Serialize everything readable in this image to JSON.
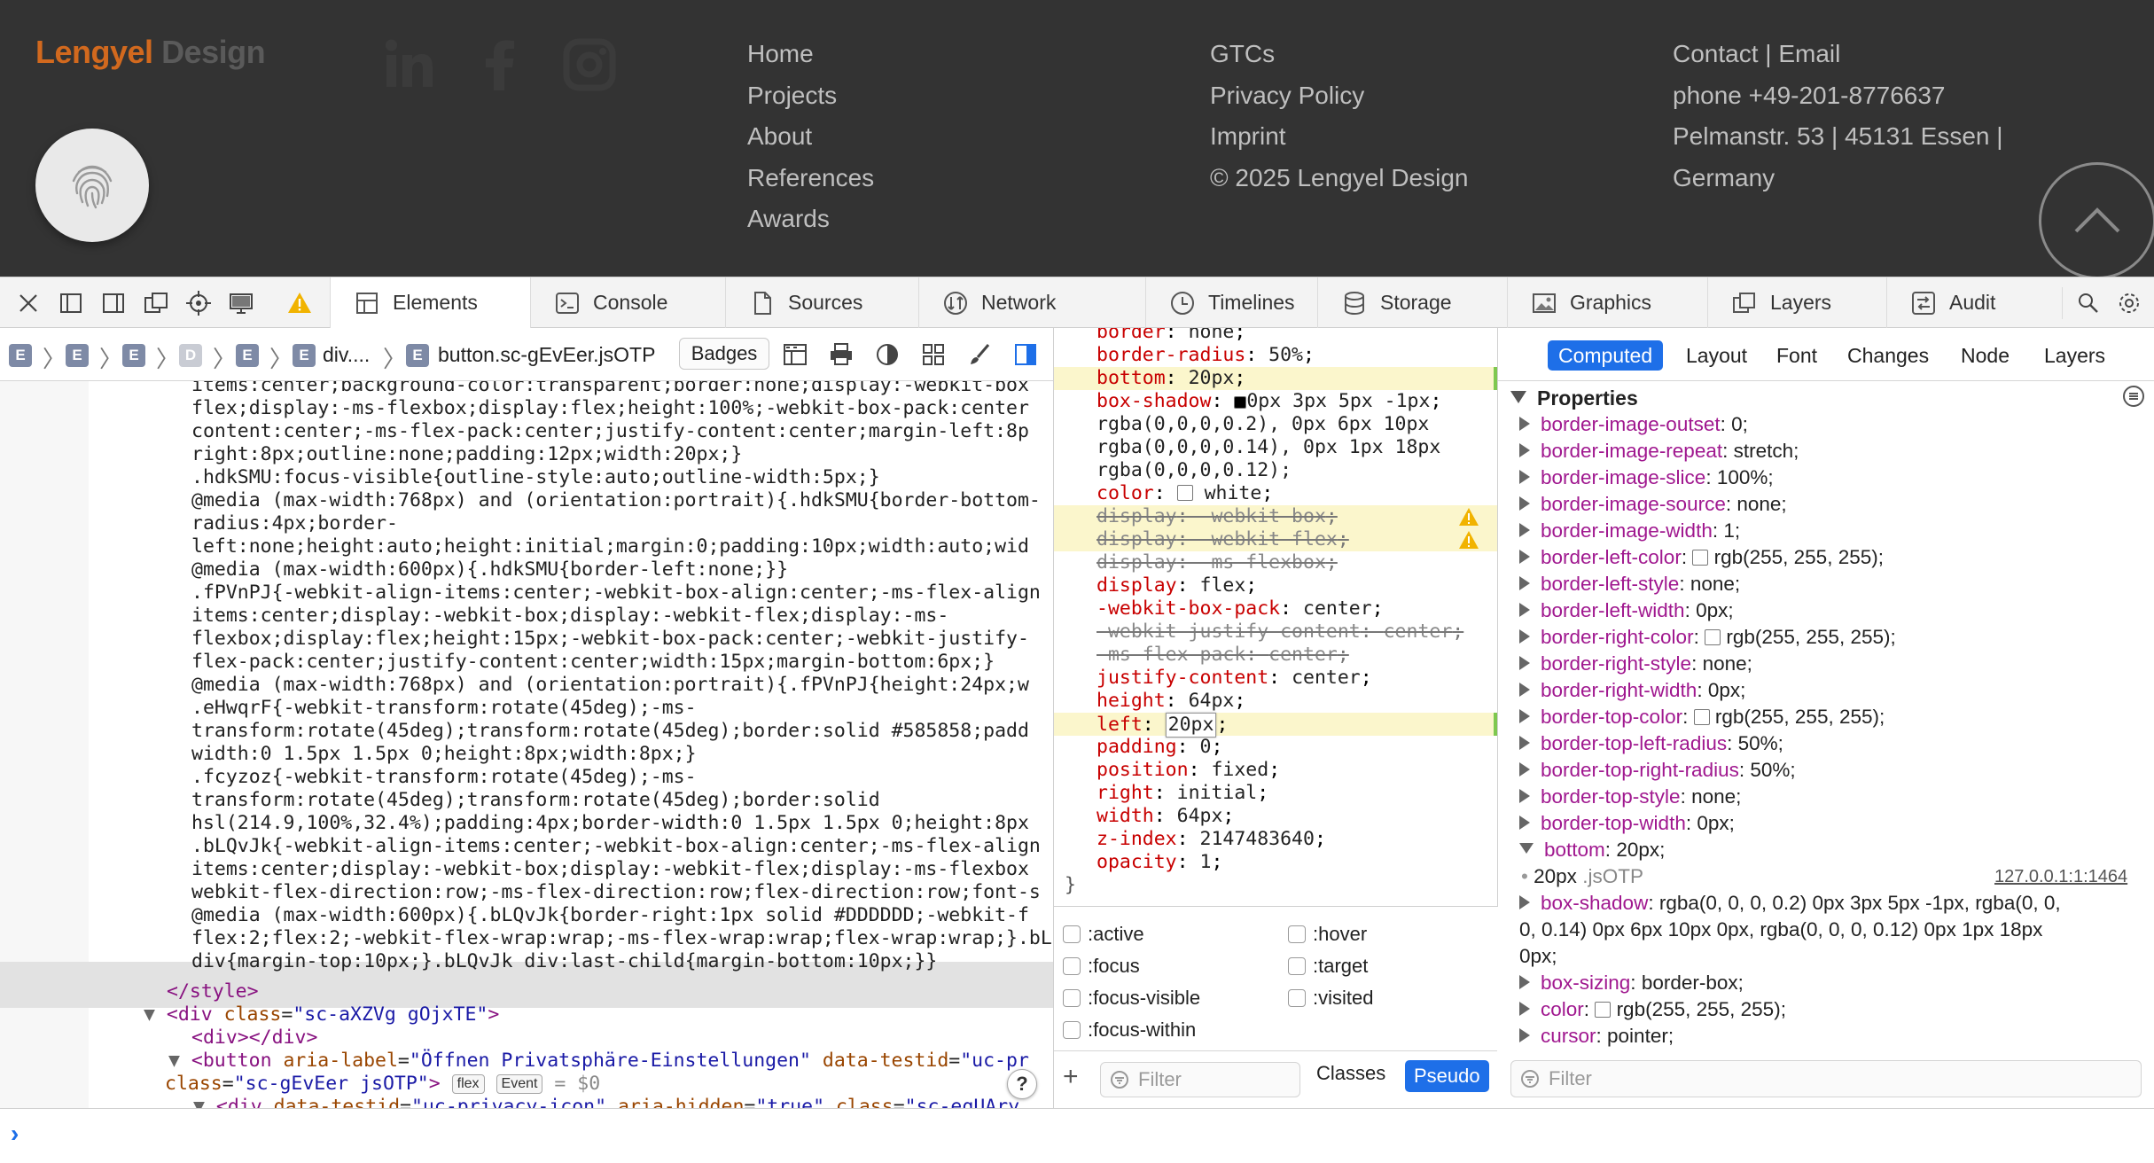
{
  "site": {
    "logo_primary": "Lengyel",
    "logo_secondary": "Design",
    "social_icons": [
      "linkedin-icon",
      "facebook-icon",
      "instagram-icon"
    ],
    "nav_links": [
      "Home",
      "Projects",
      "About",
      "References",
      "Awards"
    ],
    "legal_links": [
      "GTCs",
      "Privacy Policy",
      "Imprint",
      "© 2025 Lengyel Design"
    ],
    "contact": [
      "Contact | Email",
      "phone +49-201-8776637",
      "Pelmanstr. 53 | 45131 Essen |",
      "Germany"
    ],
    "fingerprint_button": "fingerprint-icon",
    "to_top_button": "chevron-up-icon",
    "colors": {
      "footer_bg": "#333333",
      "logo_accent": "#d2691e"
    }
  },
  "devtools": {
    "tabs": [
      "Elements",
      "Console",
      "Sources",
      "Network",
      "Timelines",
      "Storage",
      "Graphics",
      "Layers",
      "Audit"
    ],
    "active_tab": "Elements",
    "breadcrumb": {
      "items": [
        "E",
        "E",
        "E",
        "D",
        "E",
        "E"
      ],
      "current_short": "div....",
      "current": "button.sc-gEvEer.jsOTP"
    },
    "badges_label": "Badges",
    "dom_css_lines": [
      "items:center;background-color:transparent;border:none;display:-webkit-box",
      "flex;display:-ms-flexbox;display:flex;height:100%;-webkit-box-pack:center",
      "content:center;-ms-flex-pack:center;justify-content:center;margin-left:8p",
      "right:8px;outline:none;padding:12px;width:20px;}",
      ".hdkSMU:focus-visible{outline-style:auto;outline-width:5px;}",
      "@media (max-width:768px) and (orientation:portrait){.hdkSMU{border-bottom-",
      "radius:4px;border-",
      "left:none;height:auto;height:initial;margin:0;padding:10px;width:auto;wid",
      "@media (max-width:600px){.hdkSMU{border-left:none;}}",
      ".fPVnPJ{-webkit-align-items:center;-webkit-box-align:center;-ms-flex-align",
      "items:center;display:-webkit-box;display:-webkit-flex;display:-ms-",
      "flexbox;display:flex;height:15px;-webkit-box-pack:center;-webkit-justify-",
      "flex-pack:center;justify-content:center;width:15px;margin-bottom:6px;}",
      "@media (max-width:768px) and (orientation:portrait){.fPVnPJ{height:24px;w",
      ".eHwqrF{-webkit-transform:rotate(45deg);-ms-",
      "transform:rotate(45deg);transform:rotate(45deg);border:solid #585858;padd",
      "width:0 1.5px 1.5px 0;height:8px;width:8px;}",
      ".fcyzoz{-webkit-transform:rotate(45deg);-ms-",
      "transform:rotate(45deg);transform:rotate(45deg);border:solid",
      "hsl(214.9,100%,32.4%);padding:4px;border-width:0 1.5px 1.5px 0;height:8px",
      ".bLQvJk{-webkit-align-items:center;-webkit-box-align:center;-ms-flex-align",
      "items:center;display:-webkit-box;display:-webkit-flex;display:-ms-flexbox",
      "webkit-flex-direction:row;-ms-flex-direction:row;flex-direction:row;font-s",
      "@media (max-width:600px){.bLQvJk{border-right:1px solid #DDDDDD;-webkit-f",
      "flex:2;flex:2;-webkit-flex-wrap:wrap;-ms-flex-wrap:wrap;flex-wrap:wrap;}.bL",
      "div{margin-top:10px;}.bLQvJk div:last-child{margin-bottom:10px;}}"
    ],
    "dom_nodes": {
      "style_close": "</style>",
      "div_open_tag": "div",
      "div_class_attr": "class",
      "div_class_val": "\"sc-aXZVg gOjxTE\"",
      "empty_div": "<div></div>",
      "button_tag": "button",
      "button_attr1": "aria-label",
      "button_val1": "\"Öffnen Privatsphäre-Einstellungen\"",
      "button_attr2": "data-testid",
      "button_val2": "\"uc-pr",
      "button_class_attr": "class",
      "button_class_val": "\"sc-gEvEer jsOTP\"",
      "flex_badge": "flex",
      "event_badge": "Event",
      "selected_marker": "= $0",
      "child_tag": "div",
      "child_attr1": "data-testid",
      "child_val1": "\"uc-privacy-icon\"",
      "child_attr2": "aria-hidden",
      "child_val2": "\"true\"",
      "child_attr3": "class",
      "child_val3": "\"sc-eqUAry"
    },
    "help_label": "?",
    "styles": [
      {
        "name": "border",
        "value": "none",
        "state": "normal"
      },
      {
        "name": "border-radius",
        "value": "50%",
        "state": "normal"
      },
      {
        "name": "bottom",
        "value": "20px",
        "state": "highlight"
      },
      {
        "name": "box-shadow",
        "value": "0px 3px 5px -1px",
        "state": "normal"
      },
      {
        "name": "",
        "value": "rgba(0,0,0,0.2), 0px 6px 10px",
        "state": "cont"
      },
      {
        "name": "",
        "value": "rgba(0,0,0,0.14), 0px 1px 18px",
        "state": "cont"
      },
      {
        "name": "",
        "value": "rgba(0,0,0,0.12);",
        "state": "cont"
      },
      {
        "name": "color",
        "value": "white",
        "state": "normal"
      },
      {
        "name": "display",
        "value": "-webkit-box",
        "state": "struck-warn"
      },
      {
        "name": "display",
        "value": "-webkit-flex",
        "state": "struck-warn"
      },
      {
        "name": "display",
        "value": "-ms-flexbox",
        "state": "struck"
      },
      {
        "name": "display",
        "value": "flex",
        "state": "normal"
      },
      {
        "name": "-webkit-box-pack",
        "value": "center",
        "state": "normal"
      },
      {
        "name": "-webkit-justify-content",
        "value": "center",
        "state": "struck"
      },
      {
        "name": "-ms-flex-pack",
        "value": "center",
        "state": "struck"
      },
      {
        "name": "justify-content",
        "value": "center",
        "state": "normal"
      },
      {
        "name": "height",
        "value": "64px",
        "state": "normal"
      },
      {
        "name": "left",
        "value": "20px",
        "state": "editing"
      },
      {
        "name": "padding",
        "value": "0",
        "state": "normal"
      },
      {
        "name": "position",
        "value": "fixed",
        "state": "normal"
      },
      {
        "name": "right",
        "value": "initial",
        "state": "normal"
      },
      {
        "name": "width",
        "value": "64px",
        "state": "normal"
      },
      {
        "name": "z-index",
        "value": "2147483640",
        "state": "normal"
      },
      {
        "name": "opacity",
        "value": "1",
        "state": "normal"
      }
    ],
    "rule_close": "}",
    "pseudo_classes": [
      ":active",
      ":hover",
      ":focus",
      ":target",
      ":focus-visible",
      ":visited",
      ":focus-within"
    ],
    "styles_filter_placeholder": "Filter",
    "classes_label": "Classes",
    "pseudo_label": "Pseudo",
    "computed_tabs": [
      "Computed",
      "Layout",
      "Font",
      "Changes",
      "Node",
      "Layers"
    ],
    "properties_heading": "Properties",
    "computed": [
      {
        "name": "border-image-outset",
        "value": "0"
      },
      {
        "name": "border-image-repeat",
        "value": "stretch"
      },
      {
        "name": "border-image-slice",
        "value": "100%"
      },
      {
        "name": "border-image-source",
        "value": "none"
      },
      {
        "name": "border-image-width",
        "value": "1"
      },
      {
        "name": "border-left-color",
        "value": "rgb(255, 255, 255)",
        "swatch": true
      },
      {
        "name": "border-left-style",
        "value": "none"
      },
      {
        "name": "border-left-width",
        "value": "0px"
      },
      {
        "name": "border-right-color",
        "value": "rgb(255, 255, 255)",
        "swatch": true
      },
      {
        "name": "border-right-style",
        "value": "none"
      },
      {
        "name": "border-right-width",
        "value": "0px"
      },
      {
        "name": "border-top-color",
        "value": "rgb(255, 255, 255)",
        "swatch": true
      },
      {
        "name": "border-top-left-radius",
        "value": "50%"
      },
      {
        "name": "border-top-right-radius",
        "value": "50%"
      },
      {
        "name": "border-top-style",
        "value": "none"
      },
      {
        "name": "border-top-width",
        "value": "0px"
      }
    ],
    "computed_bottom": {
      "name": "bottom",
      "value": "20px",
      "source_value": "20px",
      "source_selector": ".jsOTP",
      "source_location": "127.0.0.1:1:1464"
    },
    "computed_box_shadow": {
      "name": "box-shadow",
      "line1": "rgba(0, 0, 0, 0.2) 0px 3px 5px -1px, rgba(0, 0,",
      "line2": "0, 0.14) 0px 6px 10px 0px, rgba(0, 0, 0, 0.12) 0px 1px 18px",
      "line3": "0px"
    },
    "computed_tail": [
      {
        "name": "box-sizing",
        "value": "border-box"
      },
      {
        "name": "color",
        "value": "rgb(255, 255, 255)",
        "swatch": true
      },
      {
        "name": "cursor",
        "value": "pointer"
      }
    ],
    "computed_filter_placeholder": "Filter",
    "colors": {
      "accent": "#1e6fe8",
      "prop_name_styles": "#c80000",
      "prop_name_computed": "#a0188f",
      "highlight": "#fbf6cc"
    }
  }
}
